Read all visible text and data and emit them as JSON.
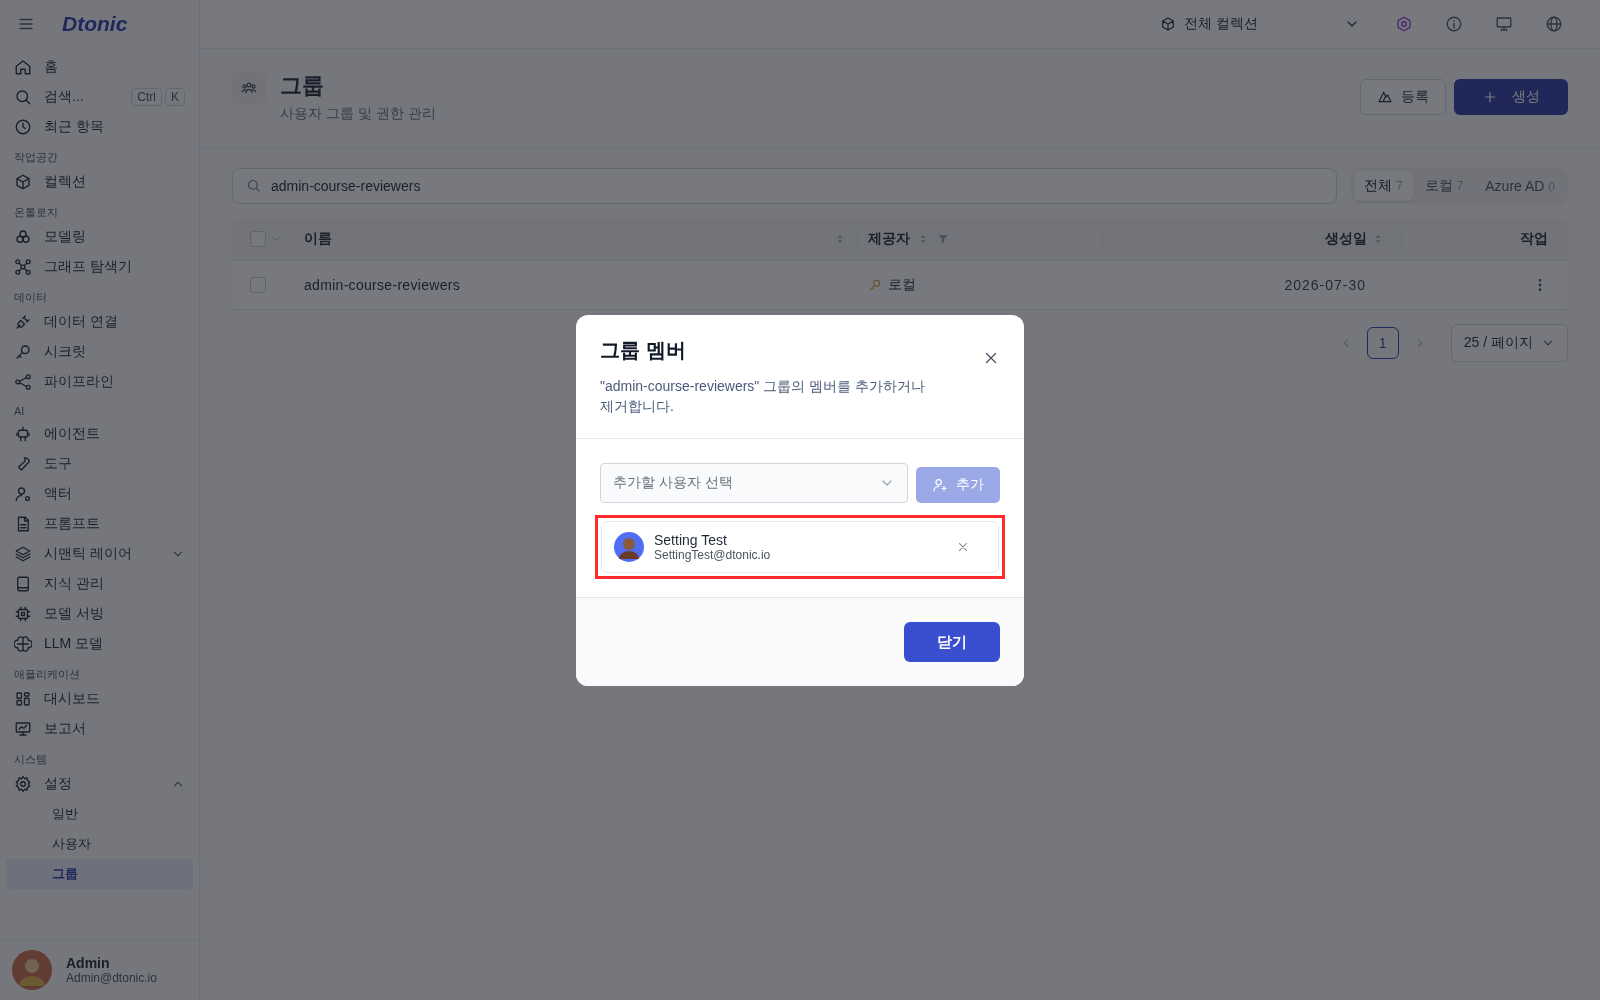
{
  "app": {
    "logo": "Dtonic"
  },
  "sidebar": {
    "top_items": [
      {
        "label": "홈"
      },
      {
        "label": "검색...",
        "shortcut": [
          "Ctrl",
          "K"
        ]
      },
      {
        "label": "최근 항목"
      }
    ],
    "sections": [
      {
        "title": "작업공간",
        "items": [
          {
            "label": "컬렉션"
          }
        ]
      },
      {
        "title": "온톨로지",
        "items": [
          {
            "label": "모델링"
          },
          {
            "label": "그래프 탐색기"
          }
        ]
      },
      {
        "title": "데이터",
        "items": [
          {
            "label": "데이터 연결"
          },
          {
            "label": "시크릿"
          },
          {
            "label": "파이프라인"
          }
        ]
      },
      {
        "title": "AI",
        "items": [
          {
            "label": "에이전트"
          },
          {
            "label": "도구"
          },
          {
            "label": "액터"
          },
          {
            "label": "프롬프트"
          },
          {
            "label": "시맨틱 레이어",
            "expanded": false
          },
          {
            "label": "지식 관리"
          },
          {
            "label": "모델 서빙"
          },
          {
            "label": "LLM 모델"
          }
        ]
      },
      {
        "title": "애플리케이션",
        "items": [
          {
            "label": "대시보드"
          },
          {
            "label": "보고서"
          }
        ]
      },
      {
        "title": "시스템",
        "items": [
          {
            "label": "설정",
            "expanded": true,
            "children": [
              {
                "label": "일반",
                "selected": false
              },
              {
                "label": "사용자",
                "selected": false
              },
              {
                "label": "그룹",
                "selected": true
              }
            ]
          }
        ]
      }
    ],
    "user": {
      "name": "Admin",
      "email": "Admin@dtonic.io"
    }
  },
  "topbar": {
    "collection": "전체 컬렉션"
  },
  "page": {
    "title": "그룹",
    "subtitle": "사용자 그룹 및 권한 관리",
    "buttons": [
      {
        "label": "등록",
        "kind": "secondary"
      },
      {
        "label": "생성",
        "kind": "primary"
      }
    ]
  },
  "search": {
    "value": "admin-course-reviewers"
  },
  "filter_tabs": [
    {
      "label": "전체",
      "count": "7",
      "selected": true
    },
    {
      "label": "로컬",
      "count": "7",
      "selected": false
    },
    {
      "label": "Azure AD",
      "count": "0",
      "selected": false
    }
  ],
  "table": {
    "select_all_checked": false,
    "columns": [
      {
        "label": "이름"
      },
      {
        "label": "제공자"
      },
      {
        "label": "생성일"
      },
      {
        "label": "작업"
      }
    ],
    "rows": [
      {
        "name": "admin-course-reviewers",
        "provider": "로컬",
        "created": "2026-07-30",
        "checked": false
      }
    ]
  },
  "pagination": {
    "pages": [
      {
        "label": "1",
        "selected": true
      }
    ],
    "page_size": "25 / 페이지"
  },
  "dialog": {
    "title": "그룹 멤버",
    "description": "\"admin-course-reviewers\" 그룹의 멤버를 추가하거나 제거합니다.",
    "user_select": {
      "placeholder": "추가할 사용자 선택"
    },
    "add_button": {
      "label": "추가",
      "disabled": true
    },
    "members": [
      {
        "name": "Setting Test",
        "email": "SettingTest@dtonic.io",
        "highlighted": true
      }
    ],
    "close_button": "닫기"
  }
}
